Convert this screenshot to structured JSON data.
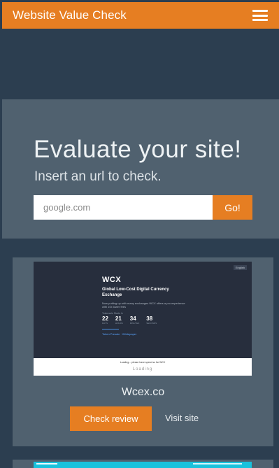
{
  "navbar": {
    "brand": "Website Value Check",
    "menu_icon": "hamburger-menu-icon",
    "color": "#e67e22"
  },
  "hero": {
    "title": "Evaluate your site!",
    "subtitle": "Insert an url to check.",
    "input_placeholder": "google.com",
    "go_label": "Go!"
  },
  "results": [
    {
      "thumbnail": {
        "lang": "English",
        "logo": "WCX",
        "headline": "Global Low-Cost Digital Currency Exchange",
        "body": "Now putting up with many exchanges WCX offers a pro experience with 10x lower fees",
        "countdown_label": "Tokensale Starts In",
        "countdown": [
          {
            "value": "22",
            "label": "DAYS"
          },
          {
            "value": "21",
            "label": "HOURS"
          },
          {
            "value": "34",
            "label": "MINUTES"
          },
          {
            "value": "38",
            "label": "SECONDS"
          }
        ],
        "links": "Token Presale  ·  Whitepaper",
        "loading": "Loading... please have spend so far WCX",
        "bottom_text": "Loading"
      },
      "site_name": "Wcex.co",
      "check_label": "Check review",
      "visit_label": "Visit site"
    }
  ],
  "colors": {
    "background": "#2c3e50",
    "hero_band": "#50616f",
    "accent": "#e67e22"
  }
}
